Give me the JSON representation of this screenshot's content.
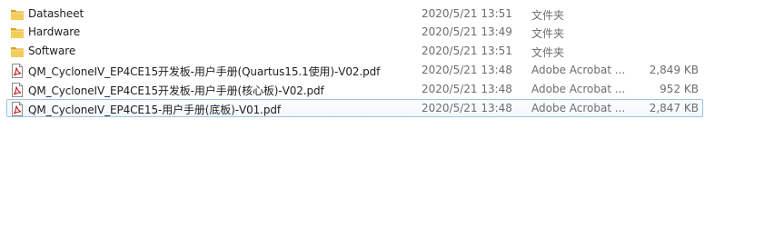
{
  "files": [
    {
      "name": "Datasheet",
      "date": "2020/5/21 13:51",
      "type": "文件夹",
      "size": "",
      "icon": "folder-icon",
      "selected": false
    },
    {
      "name": "Hardware",
      "date": "2020/5/21 13:49",
      "type": "文件夹",
      "size": "",
      "icon": "folder-icon",
      "selected": false
    },
    {
      "name": "Software",
      "date": "2020/5/21 13:51",
      "type": "文件夹",
      "size": "",
      "icon": "folder-icon",
      "selected": false
    },
    {
      "name": "QM_CycloneIV_EP4CE15开发板-用户手册(Quartus15.1使用)-V02.pdf",
      "date": "2020/5/21 13:48",
      "type": "Adobe Acrobat ...",
      "size": "2,849 KB",
      "icon": "pdf-icon",
      "selected": false
    },
    {
      "name": "QM_CycloneIV_EP4CE15开发板-用户手册(核心板)-V02.pdf",
      "date": "2020/5/21 13:48",
      "type": "Adobe Acrobat ...",
      "size": "952 KB",
      "icon": "pdf-icon",
      "selected": false
    },
    {
      "name": "QM_CycloneIV_EP4CE15-用户手册(底板)-V01.pdf",
      "date": "2020/5/21 13:48",
      "type": "Adobe Acrobat ...",
      "size": "2,847 KB",
      "icon": "pdf-icon",
      "selected": true
    }
  ],
  "colors": {
    "folder": "#e8b739",
    "pdf_red": "#c4161c",
    "selection_border": "#9ec3ea"
  }
}
